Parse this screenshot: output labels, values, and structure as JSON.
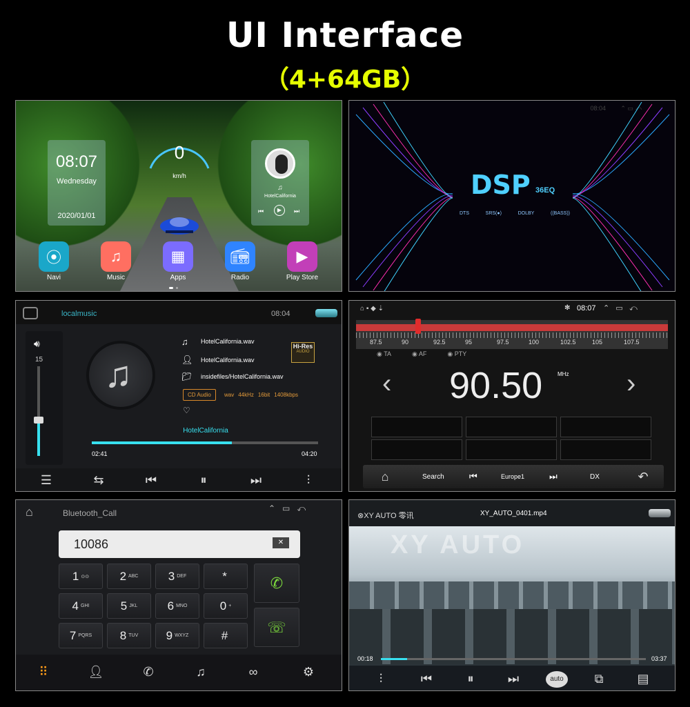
{
  "header": {
    "title": "UI  Interface",
    "subtitle": "（4+64GB）"
  },
  "home": {
    "time": "08:07",
    "day": "Wednesday",
    "date": "2020/01/01",
    "speed": "0",
    "speed_unit": "km/h",
    "song": "HotelCalifornia",
    "apps": [
      {
        "label": "Navi",
        "icon": "navi-icon",
        "color": "#1aa7c9"
      },
      {
        "label": "Music",
        "icon": "music-icon",
        "color": "#ff6f61"
      },
      {
        "label": "Apps",
        "icon": "apps-icon",
        "color": "#7b6cff"
      },
      {
        "label": "Radio",
        "icon": "radio-icon",
        "color": "#2f84ff"
      },
      {
        "label": "Play Store",
        "icon": "play-store-icon",
        "color": "#c23fb8"
      }
    ]
  },
  "dsp": {
    "time": "08:04",
    "title": "DSP",
    "subtitle": "36EQ",
    "logos": [
      "DTS",
      "SRS(●)",
      "DOLBY",
      "((BASS))"
    ]
  },
  "music": {
    "app": "localmusic",
    "time": "08:04",
    "volume": "15",
    "title": "HotelCalifornia.wav",
    "artist": "HotelCalifornia.wav",
    "path": "insidefiles/HotelCalifornia.wav",
    "badge_hires": "Hi-Res",
    "badge_audio": "AUDIO",
    "format_label": "CD Audio",
    "format_tags": [
      "wav",
      "44kHz",
      "16bit",
      "1408kbps"
    ],
    "now_playing": "HotelCalifornia",
    "elapsed": "02:41",
    "duration": "04:20",
    "progress": 0.62
  },
  "radio": {
    "time": "08:07",
    "scale": [
      "87.5",
      "90",
      "92.5",
      "95",
      "97.5",
      "100",
      "102.5",
      "105",
      "107.5"
    ],
    "flags": [
      "TA",
      "AF",
      "PTY"
    ],
    "frequency": "90.50",
    "unit": "MHz",
    "search": "Search",
    "band": "Europe1",
    "dx": "DX"
  },
  "phone": {
    "title": "Bluetooth_Call",
    "number": "10086",
    "keys": [
      {
        "d": "1",
        "s": "⊙⊙"
      },
      {
        "d": "2",
        "s": "ABC"
      },
      {
        "d": "3",
        "s": "DEF"
      },
      {
        "d": "*",
        "s": ""
      },
      {
        "d": "4",
        "s": "GHI"
      },
      {
        "d": "5",
        "s": "JKL"
      },
      {
        "d": "6",
        "s": "MNO"
      },
      {
        "d": "0",
        "s": "+"
      },
      {
        "d": "7",
        "s": "PQRS"
      },
      {
        "d": "8",
        "s": "TUV"
      },
      {
        "d": "9",
        "s": "WXYZ"
      },
      {
        "d": "#",
        "s": ""
      }
    ]
  },
  "video": {
    "brand": "XY AUTO",
    "brand_cn": "零讯",
    "file": "XY_AUTO_0401.mp4",
    "watermark": "XY AUTO",
    "elapsed": "00:18",
    "duration": "03:37",
    "progress": 0.1,
    "auto": "auto"
  }
}
